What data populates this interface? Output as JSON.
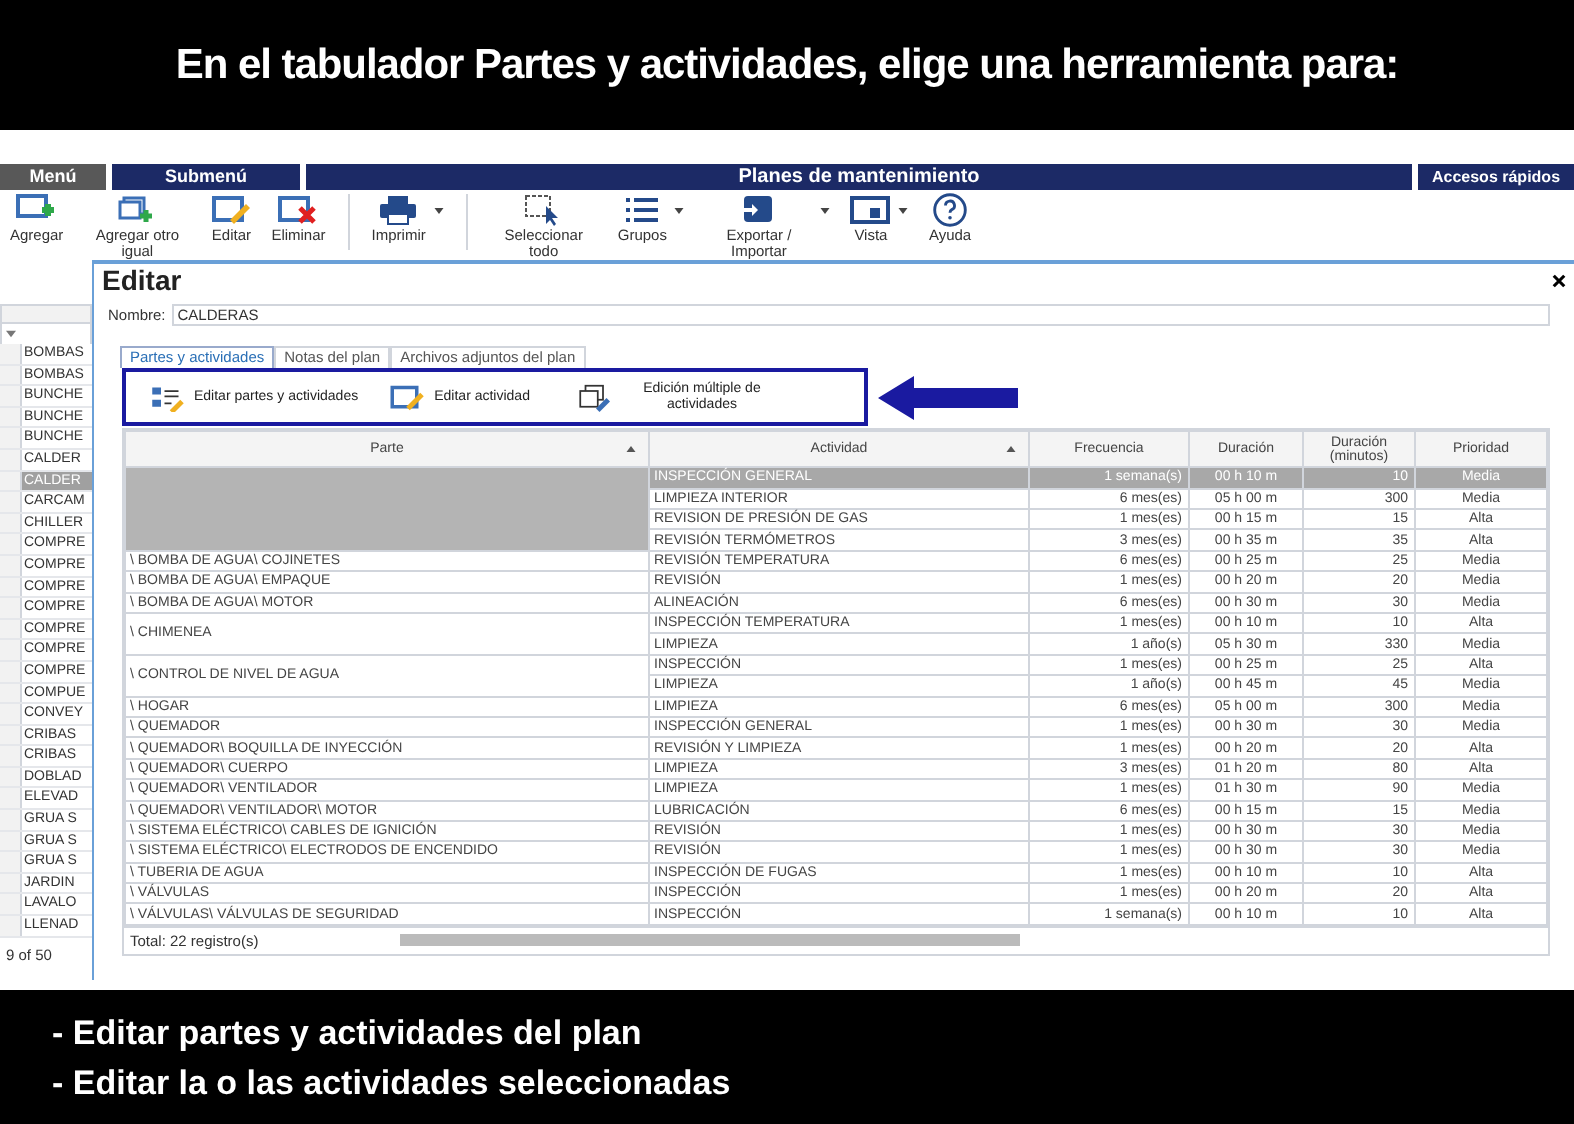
{
  "banner": {
    "title": "En el tabulador Partes y actividades, elige una herramienta para:"
  },
  "menubar": {
    "menu": "Menú",
    "submenu": "Submenú",
    "title": "Planes de mantenimiento",
    "quick_access": "Accesos rápidos"
  },
  "toolbar": [
    {
      "kind": "add",
      "label": "Agregar",
      "dropdown": false
    },
    {
      "kind": "copy",
      "label": "Agregar otro igual",
      "dropdown": false
    },
    {
      "kind": "edit",
      "label": "Editar",
      "dropdown": false
    },
    {
      "kind": "delete",
      "label": "Eliminar",
      "dropdown": false
    },
    {
      "kind": "print",
      "label": "Imprimir",
      "dropdown": true
    },
    {
      "kind": "select",
      "label": "Seleccionar todo",
      "dropdown": false
    },
    {
      "kind": "groups",
      "label": "Grupos",
      "dropdown": true
    },
    {
      "kind": "export",
      "label": "Exportar / Importar",
      "dropdown": true
    },
    {
      "kind": "view",
      "label": "Vista",
      "dropdown": true
    },
    {
      "kind": "help",
      "label": "Ayuda",
      "dropdown": false
    }
  ],
  "left_list": {
    "items": [
      {
        "label": "BOMBAS",
        "selected": false
      },
      {
        "label": "BOMBAS",
        "selected": false
      },
      {
        "label": "BUNCHE",
        "selected": false
      },
      {
        "label": "BUNCHE",
        "selected": false
      },
      {
        "label": "BUNCHE",
        "selected": false
      },
      {
        "label": "CALDER",
        "selected": false
      },
      {
        "label": "CALDER",
        "selected": true
      },
      {
        "label": "CARCAM",
        "selected": false
      },
      {
        "label": "CHILLER",
        "selected": false
      },
      {
        "label": "COMPRE",
        "selected": false
      },
      {
        "label": "COMPRE",
        "selected": false
      },
      {
        "label": "COMPRE",
        "selected": false
      },
      {
        "label": "COMPRE",
        "selected": false
      },
      {
        "label": "COMPRE",
        "selected": false
      },
      {
        "label": "COMPRE",
        "selected": false
      },
      {
        "label": "COMPRE",
        "selected": false
      },
      {
        "label": "COMPUE",
        "selected": false
      },
      {
        "label": "CONVEY",
        "selected": false
      },
      {
        "label": "CRIBAS",
        "selected": false
      },
      {
        "label": "CRIBAS",
        "selected": false
      },
      {
        "label": "DOBLAD",
        "selected": false
      },
      {
        "label": "ELEVAD",
        "selected": false
      },
      {
        "label": "GRUA S",
        "selected": false
      },
      {
        "label": "GRUA S",
        "selected": false
      },
      {
        "label": "GRUA S",
        "selected": false
      },
      {
        "label": "JARDIN",
        "selected": false
      },
      {
        "label": "LAVALO",
        "selected": false
      },
      {
        "label": "LLENAD",
        "selected": false
      }
    ],
    "pager": "9 of 50"
  },
  "dialog": {
    "title": "Editar",
    "name_label": "Nombre:",
    "name_value": "CALDERAS",
    "tabs": [
      {
        "label": "Partes y actividades",
        "selected": true
      },
      {
        "label": "Notas del plan",
        "selected": false
      },
      {
        "label": "Archivos adjuntos del plan",
        "selected": false
      }
    ],
    "tools": [
      {
        "kind": "edit_parts",
        "label": "Editar partes y actividades"
      },
      {
        "kind": "edit_activity",
        "label": "Editar actividad"
      },
      {
        "kind": "multi_edit",
        "label": "Edición múltiple de actividades"
      }
    ],
    "table": {
      "columns": [
        "Parte",
        "Actividad",
        "Frecuencia",
        "Duración",
        "Duración (minutos)",
        "Prioridad"
      ],
      "groups": [
        {
          "selected": true,
          "rows": [
            {
              "selected": true,
              "cells": [
                "INSPECCIÓN GENERAL",
                "1 semana(s)",
                "00 h 10 m",
                "10",
                "Media"
              ]
            },
            {
              "selected": false,
              "cells": [
                "LIMPIEZA  INTERIOR",
                "6 mes(es)",
                "05 h 00 m",
                "300",
                "Media"
              ]
            },
            {
              "selected": false,
              "cells": [
                "REVISION DE PRESIÓN DE GAS",
                "1 mes(es)",
                "00 h 15 m",
                "15",
                "Alta"
              ]
            },
            {
              "selected": false,
              "cells": [
                "REVISIÓN TERMÓMETROS",
                "3 mes(es)",
                "00 h 35 m",
                "35",
                "Alta"
              ]
            }
          ]
        },
        {
          "part": "\\ BOMBA DE AGUA\\ COJINETES",
          "selected": false,
          "rows": [
            {
              "selected": false,
              "cells": [
                "REVISIÓN TEMPERATURA",
                "6 mes(es)",
                "00 h 25 m",
                "25",
                "Media"
              ]
            }
          ]
        },
        {
          "part": "\\ BOMBA DE AGUA\\ EMPAQUE",
          "selected": false,
          "rows": [
            {
              "selected": false,
              "cells": [
                "REVISIÓN",
                "1 mes(es)",
                "00 h 20 m",
                "20",
                "Media"
              ]
            }
          ]
        },
        {
          "part": "\\ BOMBA DE AGUA\\ MOTOR",
          "selected": false,
          "rows": [
            {
              "selected": false,
              "cells": [
                "ALINEACIÓN",
                "6 mes(es)",
                "00 h 30 m",
                "30",
                "Media"
              ]
            }
          ]
        },
        {
          "part": "\\ CHIMENEA",
          "selected": false,
          "rows": [
            {
              "selected": false,
              "cells": [
                "INSPECCIÓN TEMPERATURA",
                "1 mes(es)",
                "00 h 10 m",
                "10",
                "Alta"
              ]
            },
            {
              "selected": false,
              "cells": [
                "LIMPIEZA",
                "1 año(s)",
                "05 h 30 m",
                "330",
                "Media"
              ]
            }
          ]
        },
        {
          "part": "\\ CONTROL DE NIVEL DE AGUA",
          "selected": false,
          "rows": [
            {
              "selected": false,
              "cells": [
                "INSPECCIÓN",
                "1 mes(es)",
                "00 h 25 m",
                "25",
                "Alta"
              ]
            },
            {
              "selected": false,
              "cells": [
                "LIMPIEZA",
                "1 año(s)",
                "00 h 45 m",
                "45",
                "Media"
              ]
            }
          ]
        },
        {
          "part": "\\ HOGAR",
          "selected": false,
          "rows": [
            {
              "selected": false,
              "cells": [
                "LIMPIEZA",
                "6 mes(es)",
                "05 h 00 m",
                "300",
                "Media"
              ]
            }
          ]
        },
        {
          "part": "\\ QUEMADOR",
          "selected": false,
          "rows": [
            {
              "selected": false,
              "cells": [
                "INSPECCIÓN GENERAL",
                "1 mes(es)",
                "00 h 30 m",
                "30",
                "Media"
              ]
            }
          ]
        },
        {
          "part": "\\ QUEMADOR\\ BOQUILLA DE INYECCIÓN",
          "selected": false,
          "rows": [
            {
              "selected": false,
              "cells": [
                "REVISIÓN Y LIMPIEZA",
                "1 mes(es)",
                "00 h 20 m",
                "20",
                "Alta"
              ]
            }
          ]
        },
        {
          "part": "\\ QUEMADOR\\ CUERPO",
          "selected": false,
          "rows": [
            {
              "selected": false,
              "cells": [
                "LIMPIEZA",
                "3 mes(es)",
                "01 h 20 m",
                "80",
                "Alta"
              ]
            }
          ]
        },
        {
          "part": "\\ QUEMADOR\\ VENTILADOR",
          "selected": false,
          "rows": [
            {
              "selected": false,
              "cells": [
                "LIMPIEZA",
                "1 mes(es)",
                "01 h 30 m",
                "90",
                "Media"
              ]
            }
          ]
        },
        {
          "part": "\\ QUEMADOR\\ VENTILADOR\\ MOTOR",
          "selected": false,
          "rows": [
            {
              "selected": false,
              "cells": [
                "LUBRICACIÓN",
                "6 mes(es)",
                "00 h 15 m",
                "15",
                "Media"
              ]
            }
          ]
        },
        {
          "part": "\\ SISTEMA ELÉCTRICO\\ CABLES DE IGNICIÓN",
          "selected": false,
          "rows": [
            {
              "selected": false,
              "cells": [
                "REVISIÓN",
                "1 mes(es)",
                "00 h 30 m",
                "30",
                "Media"
              ]
            }
          ]
        },
        {
          "part": "\\ SISTEMA ELÉCTRICO\\ ELECTRODOS DE ENCENDIDO",
          "selected": false,
          "rows": [
            {
              "selected": false,
              "cells": [
                "REVISIÓN",
                "1 mes(es)",
                "00 h 30 m",
                "30",
                "Media"
              ]
            }
          ]
        },
        {
          "part": "\\ TUBERIA DE AGUA",
          "selected": false,
          "rows": [
            {
              "selected": false,
              "cells": [
                "INSPECCIÓN DE FUGAS",
                "1 mes(es)",
                "00 h 10 m",
                "10",
                "Alta"
              ]
            }
          ]
        },
        {
          "part": "\\ VÁLVULAS",
          "selected": false,
          "rows": [
            {
              "selected": false,
              "cells": [
                "INSPECCIÓN",
                "1 mes(es)",
                "00 h 20 m",
                "20",
                "Alta"
              ]
            }
          ]
        },
        {
          "part": "\\ VÁLVULAS\\ VÁLVULAS DE SEGURIDAD",
          "selected": false,
          "rows": [
            {
              "selected": false,
              "cells": [
                "INSPECCIÓN",
                "1 semana(s)",
                "00 h 10 m",
                "10",
                "Alta"
              ]
            }
          ]
        }
      ],
      "total": "Total: 22 registro(s)"
    }
  },
  "notes": [
    "- Editar partes y actividades del plan",
    "- Editar la o las actividades seleccionadas"
  ]
}
